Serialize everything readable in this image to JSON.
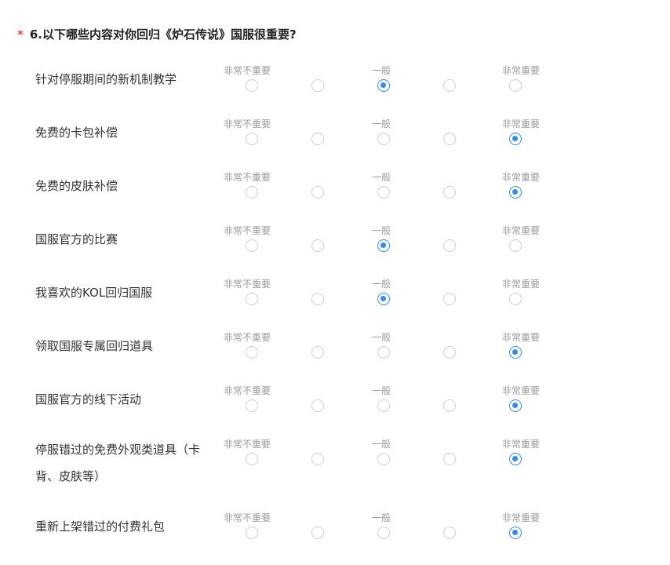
{
  "question": {
    "required_mark": "*",
    "title": "6.以下哪些内容对你回归《炉石传说》国服很重要?"
  },
  "scale": {
    "low": "非常不重要",
    "mid": "一般",
    "high": "非常重要",
    "points": 5
  },
  "accent_color": "#2f8cf4",
  "rows": [
    {
      "label": "针对停服期间的新机制教学",
      "selected": 3
    },
    {
      "label": "免费的卡包补偿",
      "selected": 5
    },
    {
      "label": "免费的皮肤补偿",
      "selected": 5
    },
    {
      "label": "国服官方的比赛",
      "selected": 3
    },
    {
      "label": "我喜欢的KOL回归国服",
      "selected": 3
    },
    {
      "label": "领取国服专属回归道具",
      "selected": 5
    },
    {
      "label": "国服官方的线下活动",
      "selected": 5
    },
    {
      "label": "停服错过的免费外观类道具（卡背、皮肤等）",
      "selected": 5
    },
    {
      "label": "重新上架错过的付费礼包",
      "selected": 5
    }
  ]
}
